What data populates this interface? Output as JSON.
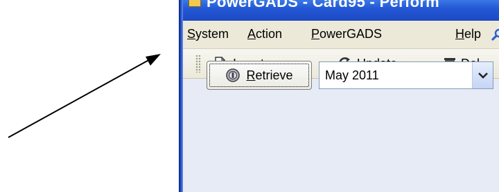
{
  "window": {
    "title": "PowerGADS - Card95 - Perform"
  },
  "menu": [
    {
      "label_pre": "",
      "label_u": "S",
      "label_post": "ystem"
    },
    {
      "label_pre": "",
      "label_u": "A",
      "label_post": "ction"
    },
    {
      "label_pre": "",
      "label_u": "P",
      "label_post": "owerGADS"
    },
    {
      "label_pre": "",
      "label_u": "H",
      "label_post": "elp"
    }
  ],
  "toolbar": {
    "insert": {
      "u": "I",
      "rest": "nsert"
    },
    "update": {
      "u": "U",
      "rest": "pdate"
    },
    "delete": {
      "u": "D",
      "rest": "el"
    }
  },
  "retrieve": {
    "u": "R",
    "rest": "etrieve"
  },
  "period": {
    "value": "May 2011"
  },
  "icons": {
    "search": "magnifier-icon",
    "insert": "insert-record-icon",
    "update": "update-arrows-icon",
    "delete": "trash-icon",
    "retrieve": "retrieve-icon",
    "dropdown": "chevron-down-icon"
  },
  "colors": {
    "titlebar": "#2458d6",
    "panel": "#e7ebf6",
    "menubar": "#ece9d8"
  }
}
